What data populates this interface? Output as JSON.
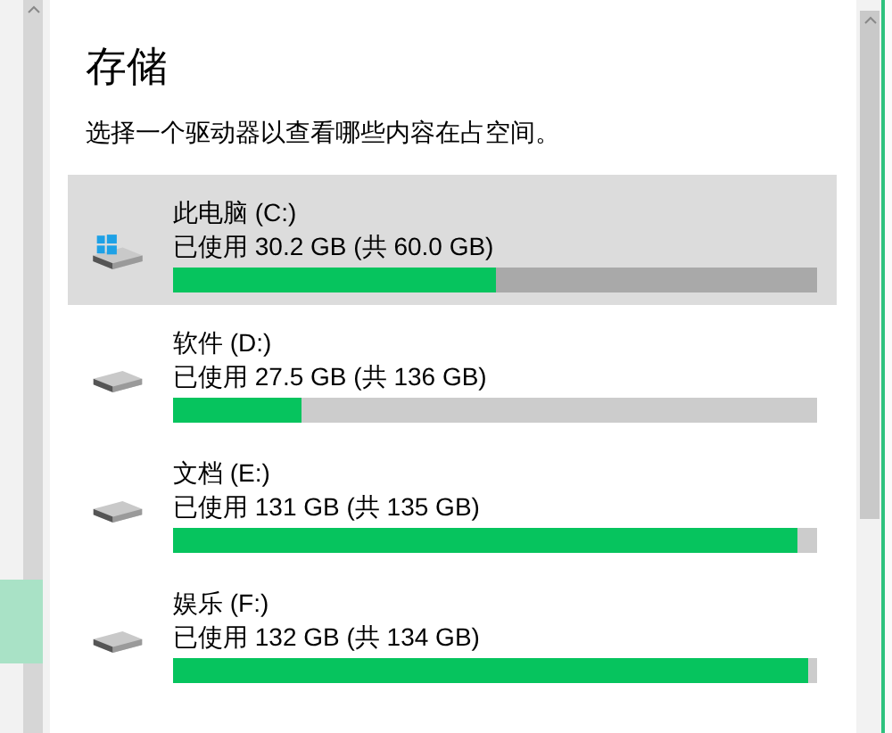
{
  "title": "存储",
  "subtitle": "选择一个驱动器以查看哪些内容在占空间。",
  "drives": [
    {
      "name": "此电脑 (C:)",
      "usage": "已使用 30.2 GB (共 60.0 GB)",
      "level": 0.5,
      "selected": true,
      "system": true
    },
    {
      "name": "软件 (D:)",
      "usage": "已使用 27.5 GB (共 136 GB)",
      "level": 0.2,
      "selected": false,
      "system": false
    },
    {
      "name": "文档 (E:)",
      "usage": "已使用 131 GB (共 135 GB)",
      "level": 0.97,
      "selected": false,
      "system": false
    },
    {
      "name": "娱乐 (F:)",
      "usage": "已使用 132 GB (共 134 GB)",
      "level": 0.985,
      "selected": false,
      "system": false
    }
  ]
}
